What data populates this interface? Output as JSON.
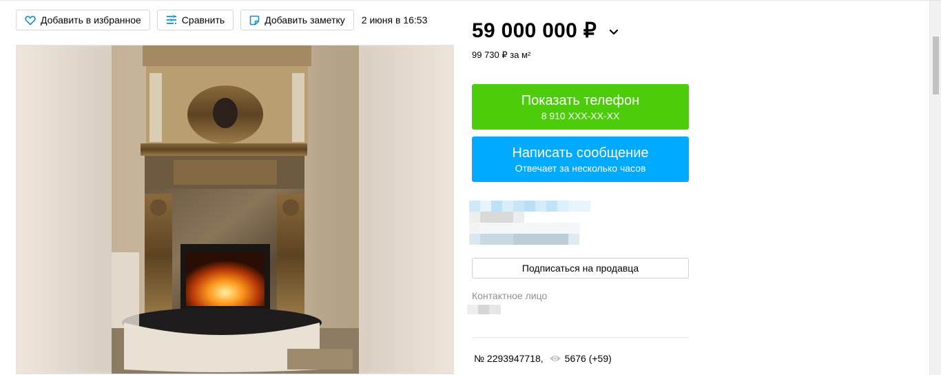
{
  "actions": {
    "favorite_label": "Добавить в избранное",
    "compare_label": "Сравнить",
    "note_label": "Добавить заметку",
    "date": "2 июня в 16:53"
  },
  "price": {
    "value": "59 000 000 ₽",
    "per_m2": "99 730 ₽ за м²"
  },
  "phone_button": {
    "title": "Показать телефон",
    "subtitle": "8 910 XXX-XX-XX"
  },
  "message_button": {
    "title": "Написать сообщение",
    "subtitle": "Отвечает за несколько часов"
  },
  "subscribe_label": "Подписаться на продавца",
  "contact_label": "Контактное лицо",
  "listing": {
    "number": "№ 2293947718,",
    "views": "5676 (+59)"
  },
  "colors": {
    "phone_button": "#4ccc0a",
    "message_button": "#00aaff",
    "icon_accent": "#0a8fd6"
  },
  "icons": {
    "favorite": "heart-icon",
    "compare": "compare-icon",
    "note": "note-icon",
    "price_toggle": "chevron-down-icon",
    "views": "eye-icon"
  }
}
